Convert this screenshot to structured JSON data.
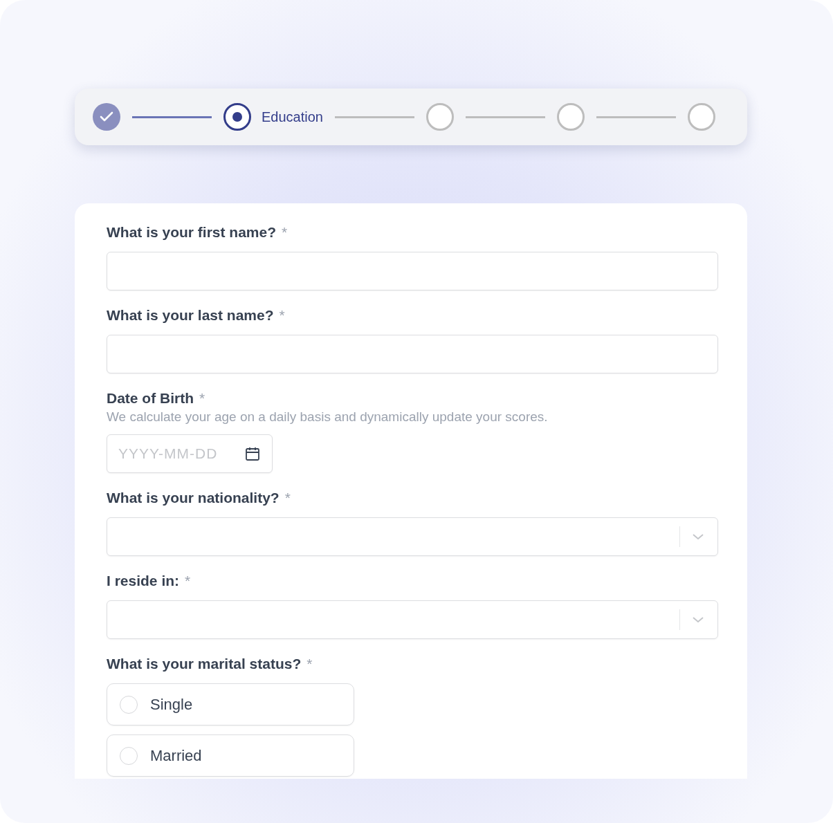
{
  "stepper": {
    "steps": [
      {
        "done": true,
        "current": false
      },
      {
        "done": false,
        "current": true,
        "label": "Education"
      },
      {
        "done": false,
        "current": false
      },
      {
        "done": false,
        "current": false
      },
      {
        "done": false,
        "current": false
      }
    ]
  },
  "form": {
    "fields": [
      {
        "kind": "text",
        "label": "What is your first name?",
        "required": "*"
      },
      {
        "kind": "text",
        "label": "What is your last name?",
        "required": "*"
      },
      {
        "kind": "date",
        "label": "Date of Birth",
        "required": "*",
        "hint": "We calculate your age on a daily basis and dynamically update your scores.",
        "placeholder": "YYYY-MM-DD"
      },
      {
        "kind": "select",
        "label": "What is your nationality?",
        "required": "*"
      },
      {
        "kind": "select",
        "label": "I reside in:",
        "required": "*"
      },
      {
        "kind": "radio",
        "label": "What is your marital status?",
        "required": "*",
        "options": [
          {
            "label": "Single",
            "selected": false
          },
          {
            "label": "Married",
            "selected": false
          }
        ]
      }
    ]
  }
}
